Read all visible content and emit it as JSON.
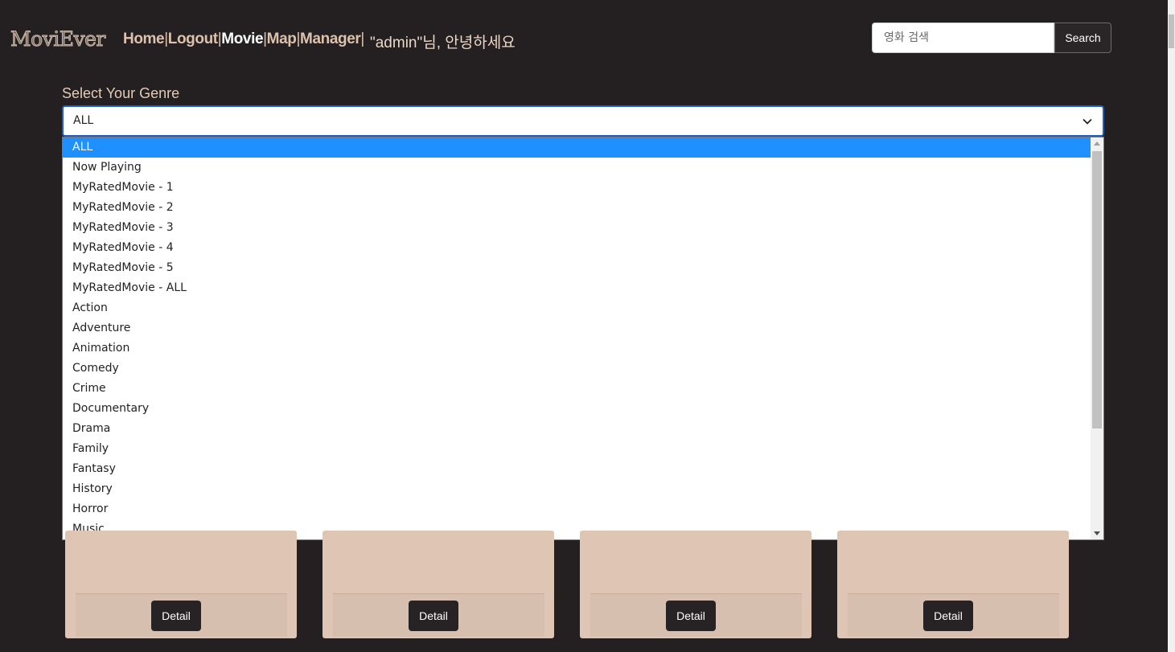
{
  "header": {
    "logo_text": "MoviEver",
    "nav": [
      {
        "label": "Home",
        "active": false
      },
      {
        "label": "Logout",
        "active": false
      },
      {
        "label": "Movie",
        "active": true
      },
      {
        "label": "Map",
        "active": false
      },
      {
        "label": "Manager",
        "active": false
      }
    ],
    "separator": "|",
    "greeting": "\"admin\"님, 안녕하세요"
  },
  "search": {
    "placeholder": "영화 검색",
    "button_label": "Search"
  },
  "genre": {
    "label": "Select Your Genre",
    "selected": "ALL",
    "options": [
      "ALL",
      "Now Playing",
      "MyRatedMovie - 1",
      "MyRatedMovie - 2",
      "MyRatedMovie - 3",
      "MyRatedMovie - 4",
      "MyRatedMovie - 5",
      "MyRatedMovie - ALL",
      "Action",
      "Adventure",
      "Animation",
      "Comedy",
      "Crime",
      "Documentary",
      "Drama",
      "Family",
      "Fantasy",
      "History",
      "Horror",
      "Music"
    ]
  },
  "cards": [
    {
      "button_label": "Detail"
    },
    {
      "button_label": "Detail"
    },
    {
      "button_label": "Detail"
    },
    {
      "button_label": "Detail"
    }
  ],
  "colors": {
    "background": "#242021",
    "accent_text": "#dcc2ad",
    "selected_option": "#1e90ff",
    "card": "#dfc5b4"
  }
}
